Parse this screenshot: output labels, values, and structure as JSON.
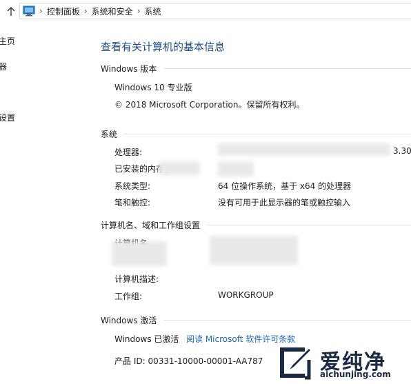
{
  "breadcrumb": {
    "items": [
      "控制面板",
      "系统和安全",
      "系统"
    ]
  },
  "left_nav": {
    "items": [
      "主页",
      "器",
      "设置"
    ]
  },
  "page_title": "查看有关计算机的基本信息",
  "windows_edition": {
    "heading": "Windows 版本",
    "edition": "Windows 10 专业版",
    "copyright": "© 2018 Microsoft Corporation。保留所有权利。"
  },
  "system": {
    "heading": "系统",
    "processor_label": "处理器:",
    "processor_value_tail": "3.30",
    "memory_label": "已安装的内存(",
    "system_type_label": "系统类型:",
    "system_type_value": "64 位操作系统，基于 x64 的处理器",
    "pen_touch_label": "笔和触控:",
    "pen_touch_value": "没有可用于此显示器的笔或触控输入"
  },
  "computer_name": {
    "heading": "计算机名、域和工作组设置",
    "computer_name_label": "计算机名",
    "description_label": "计算机描述:",
    "workgroup_label": "工作组:",
    "workgroup_value": "WORKGROUP"
  },
  "activation": {
    "heading": "Windows 激活",
    "status": "Windows 已激活",
    "license_link": "阅读 Microsoft 软件许可条款",
    "product_id": "产品 ID: 00331-10000-00001-AA787"
  },
  "watermark": {
    "brand": "爱纯净",
    "url": "aichunjing.com"
  },
  "colors": {
    "title_blue": "#1f4e8f",
    "link_blue": "#1a66c8"
  }
}
